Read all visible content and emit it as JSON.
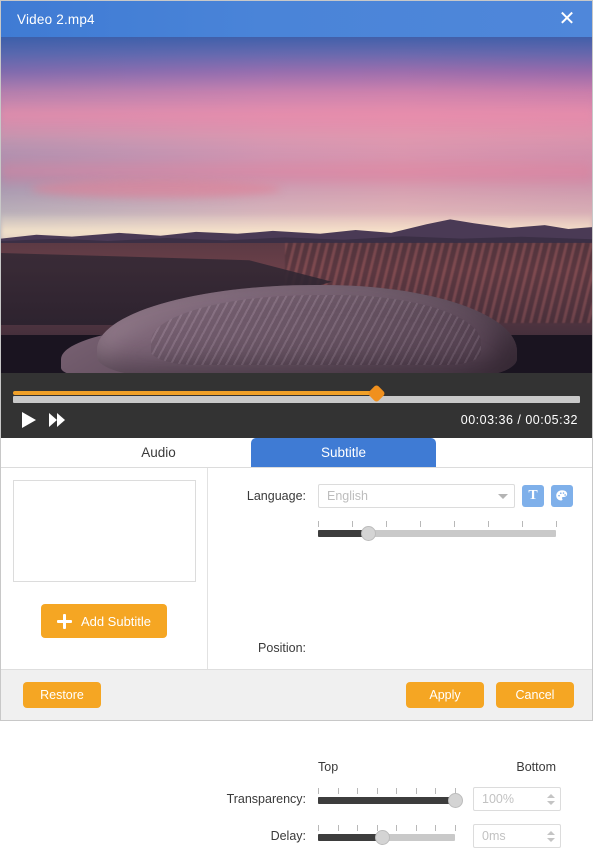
{
  "window": {
    "title": "Video 2.mp4",
    "close_icon": "close-icon"
  },
  "player": {
    "progress_percent": 64,
    "current_time": "00:03:36",
    "separator": "/",
    "total_time": "00:05:32",
    "time_display": "00:03:36 / 00:05:32",
    "play_icon": "play-icon",
    "forward_icon": "fast-forward-icon",
    "bar_color": "#f0a028",
    "background": "#333333"
  },
  "tabs": [
    {
      "label": "Audio",
      "active": false
    },
    {
      "label": "Subtitle",
      "active": true
    }
  ],
  "left_panel": {
    "list_items": [],
    "add_button": {
      "label": "Add Subtitle",
      "icon": "plus-icon",
      "color": "#f5a623"
    }
  },
  "settings": {
    "language": {
      "label": "Language:",
      "value": "",
      "placeholder": "English",
      "caret_icon": "chevron-down-icon",
      "buttons": [
        {
          "name": "font-style-button",
          "glyph": "T"
        },
        {
          "name": "color-palette-button",
          "glyph": "palette-icon"
        }
      ]
    },
    "position": {
      "label": "Position:",
      "value_percent": 21,
      "min_label": "Top",
      "max_label": "Bottom",
      "ticks": 8
    },
    "transparency": {
      "label": "Transparency:",
      "value_percent": 100,
      "field_value": "100%",
      "ticks": 8
    },
    "delay": {
      "label": "Delay:",
      "value_percent": 47,
      "field_value": "0ms",
      "ticks": 8
    }
  },
  "footer": {
    "restore": "Restore",
    "apply": "Apply",
    "cancel": "Cancel"
  },
  "theme": {
    "accent_blue": "#3f7bd4",
    "accent_orange": "#f5a623",
    "icon_button_blue": "#7fb0ea"
  }
}
